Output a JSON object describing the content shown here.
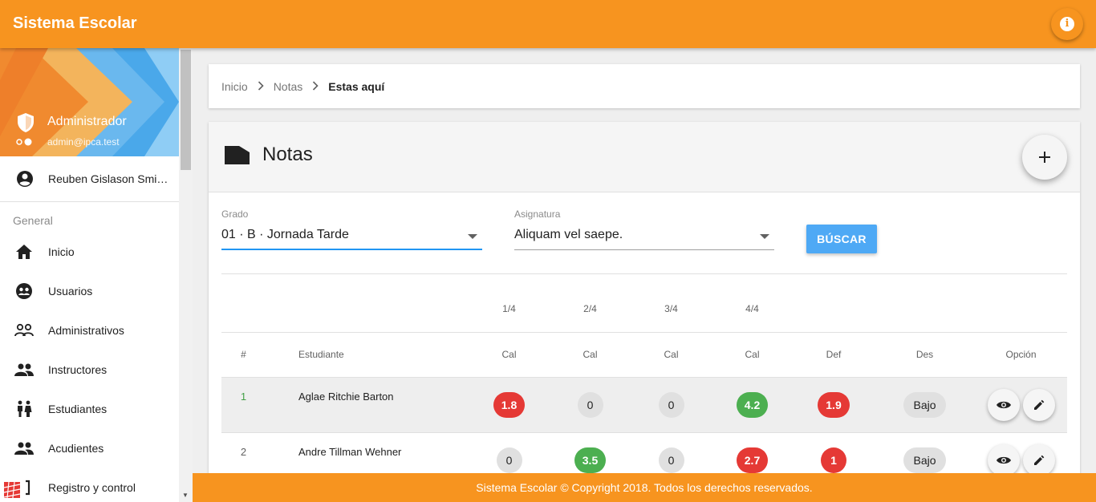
{
  "app": {
    "title": "Sistema Escolar"
  },
  "sidebar": {
    "profile": {
      "role": "Administrador",
      "email": "admin@ipca.test"
    },
    "user": "Reuben Gislason Smi…",
    "section": "General",
    "items": [
      {
        "label": "Inicio",
        "icon": "home-icon"
      },
      {
        "label": "Usuarios",
        "icon": "users-icon"
      },
      {
        "label": "Administrativos",
        "icon": "admins-icon"
      },
      {
        "label": "Instructores",
        "icon": "instructors-icon"
      },
      {
        "label": "Estudiantes",
        "icon": "students-icon"
      },
      {
        "label": "Acudientes",
        "icon": "guardians-icon"
      },
      {
        "label": "Registro y control",
        "icon": "registry-icon"
      }
    ]
  },
  "breadcrumb": {
    "items": [
      "Inicio",
      "Notas"
    ],
    "current": "Estas aquí"
  },
  "card": {
    "title": "Notas"
  },
  "filters": {
    "grado": {
      "label": "Grado",
      "value": "01 · B · Jornada Tarde"
    },
    "asignatura": {
      "label": "Asignatura",
      "value": "Aliquam vel saepe."
    },
    "search_label": "BÚSCAR"
  },
  "table": {
    "periods": [
      "1/4",
      "2/4",
      "3/4",
      "4/4"
    ],
    "headers": [
      "#",
      "Estudiante",
      "Cal",
      "Cal",
      "Cal",
      "Cal",
      "Def",
      "Des",
      "Opción"
    ],
    "rows": [
      {
        "num": "1",
        "name": "Aglae Ritchie Barton",
        "grades": [
          "1.8",
          "0",
          "0",
          "4.2"
        ],
        "def": "1.9",
        "des": "Bajo"
      },
      {
        "num": "2",
        "name": "Andre Tillman Wehner",
        "grades": [
          "0",
          "3.5",
          "0",
          "2.7"
        ],
        "def": "1",
        "des": "Bajo"
      }
    ]
  },
  "colors": {
    "primary": "#f7941f",
    "accent": "#4ea9f5",
    "low": "#e53935",
    "high": "#4caf50",
    "neutral": "#e0e0e0"
  },
  "footer": {
    "text": "Sistema Escolar © Copyright 2018. Todos los derechos reservados."
  }
}
